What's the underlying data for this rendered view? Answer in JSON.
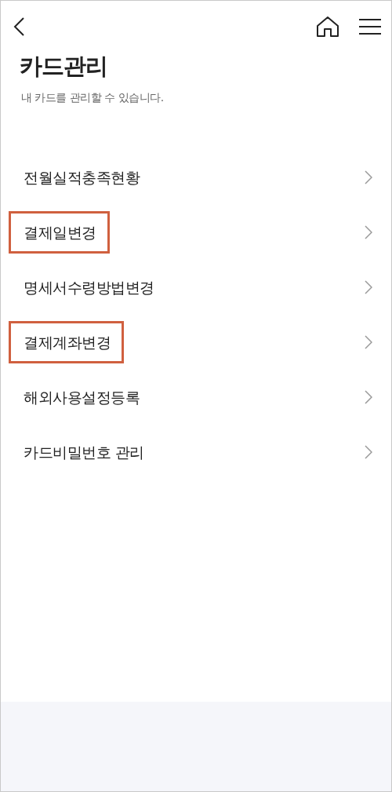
{
  "header": {
    "title": "카드관리",
    "subtitle": "내 카드를 관리할 수 있습니다."
  },
  "menu_items": [
    {
      "label": "전월실적충족현황",
      "highlighted": false
    },
    {
      "label": "결제일변경",
      "highlighted": true
    },
    {
      "label": "명세서수령방법변경",
      "highlighted": false
    },
    {
      "label": "결제계좌변경",
      "highlighted": true
    },
    {
      "label": "해외사용설정등록",
      "highlighted": false
    },
    {
      "label": "카드비밀번호 관리",
      "highlighted": false
    }
  ]
}
